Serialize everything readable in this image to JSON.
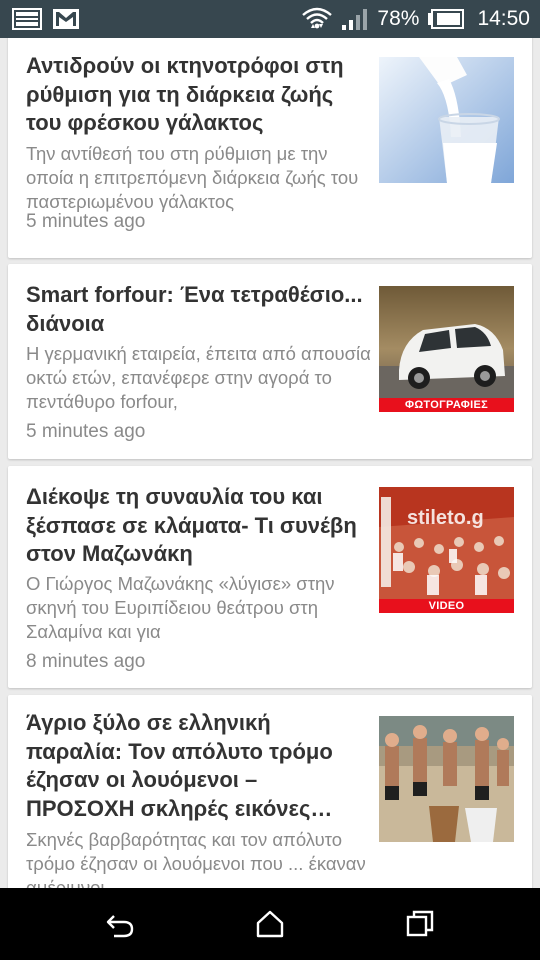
{
  "status_bar": {
    "battery_percent": "78%",
    "time": "14:50"
  },
  "articles": [
    {
      "title": "Αντιδρούν οι κτηνοτρόφοι στη ρύθμιση για τη διάρκεια ζωής του φρέσκου γάλακτος",
      "snippet": "Την αντίθεσή του στη ρύθμιση με την οποία η επιτρεπόμενη διάρκεια ζωής του παστεριωμένου γάλακτος",
      "time": "5 minutes ago",
      "thumbnail": "milk-pouring-image",
      "thumbnail_label": ""
    },
    {
      "title": "Smart forfour: Ένα τετραθέσιο... διάνοια",
      "snippet": "Η γερμανική εταιρεία, έπειτα από απουσία οκτώ ετών, επανέφερε στην αγορά το πεντάθυρο forfour,",
      "time": "5 minutes ago",
      "thumbnail": "white-car-image",
      "thumbnail_label": "ΦΩΤΟΓΡΑΦΙΕΣ"
    },
    {
      "title": "Διέκοψε τη συναυλία του και ξέσπασε σε κλάματα- Τι συνέβη στον Μαζωνάκη",
      "snippet": "Ο Γιώργος Μαζωνάκης «λύγισε» στην σκηνή του Ευριπίδειου θεάτρου στη Σαλαμίνα και για",
      "time": "8 minutes ago",
      "thumbnail": "concert-crowd-image",
      "thumbnail_label": "VIDEO",
      "thumbnail_watermark": "stileto.g"
    },
    {
      "title": "Άγριο ξύλο σε ελληνική παραλία: Τον απόλυτο τρόμο έζησαν οι λουόμενοι – ΠΡΟΣΟΧΗ σκληρές εικόνες…",
      "snippet": "Σκηνές βαρβαρότητας και τον απόλυτο τρόμο έζησαν οι λουόμενοι που ... έκαναν αμέριμνοι",
      "time": "",
      "thumbnail": "beach-fight-image",
      "thumbnail_label": ""
    }
  ],
  "nav_bar": {
    "buttons": [
      "back-icon",
      "home-icon",
      "recents-icon"
    ]
  },
  "colors": {
    "status_bar_bg": "#37474f",
    "title_text": "#333333",
    "secondary_text": "#8a8a8a",
    "label_red": "#e8101c"
  }
}
